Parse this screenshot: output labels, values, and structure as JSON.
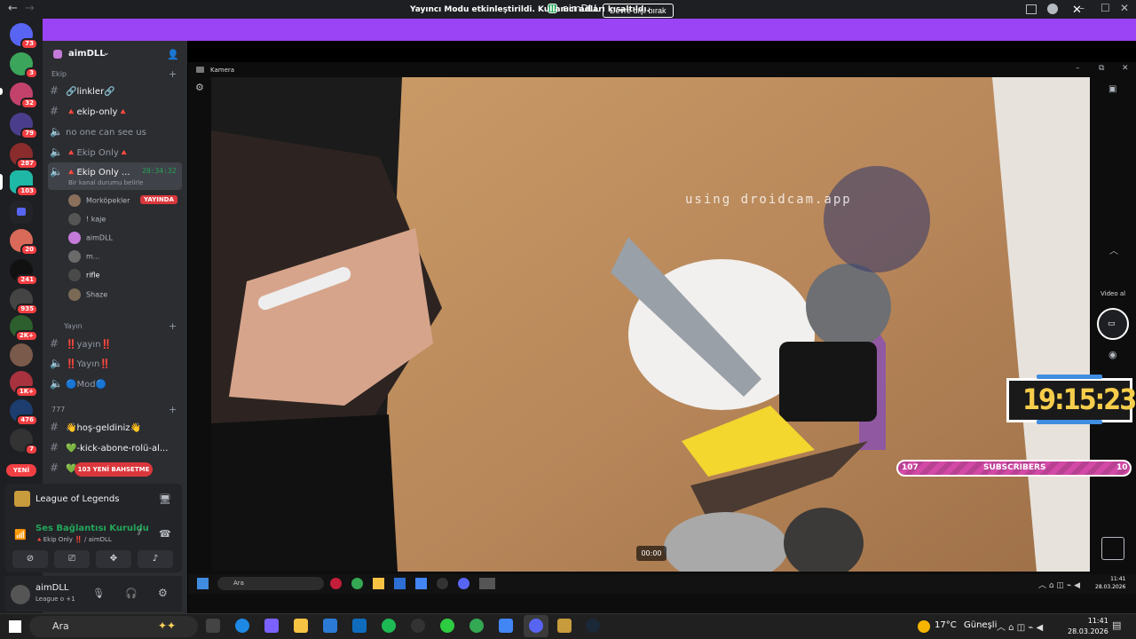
{
  "window": {
    "title": "aimDLL",
    "back": "←",
    "forward": "→",
    "minimize": "–",
    "maximize": "☐",
    "close": "✕"
  },
  "banner": {
    "text": "Yayıncı Modu etkinleştirildi. Kullanıcı adları kısaltıldı.",
    "button": "Devre dışı bırak",
    "close": "✕"
  },
  "rail": {
    "badges": [
      "73",
      "3",
      "32",
      "79",
      "287",
      "103",
      "20",
      "241",
      "935",
      "2K+",
      "1K+",
      "476",
      "7"
    ],
    "yeni": "YENİ"
  },
  "sidebar": {
    "server_name": "aimDLL",
    "categories": {
      "ekip": "Ekip",
      "yayin": "Yayın",
      "seven": "777"
    },
    "channels": [
      {
        "name": "🔗linkler🔗",
        "type": "text"
      },
      {
        "name": "🔺ekip-only🔺",
        "type": "text"
      },
      {
        "name": "no one can see us",
        "type": "voice"
      },
      {
        "name": "🔺Ekip Only🔺",
        "type": "voice"
      },
      {
        "name": "🔺Ekip Only ...",
        "type": "voice",
        "timer": "20:34:32",
        "status": "Bir kanal durumu belirle"
      }
    ],
    "members": [
      {
        "name": "Morköpekler",
        "live": "YAYINDA"
      },
      {
        "name": "! kaje"
      },
      {
        "name": "aimDLL"
      },
      {
        "name": "m..."
      },
      {
        "name": "rifle"
      },
      {
        "name": "Shaze"
      }
    ],
    "yayin_channels": [
      "‼️yayın‼️",
      "‼️Yayın‼️",
      "🔵Mod🔵"
    ],
    "seven_channels": [
      "👋hoş-geldiniz👋",
      "💚-kick-abone-rolü-al...",
      "💚"
    ],
    "new_mentions": "103 YENİ BAHSETME"
  },
  "voice_panel": {
    "game": "League of Legends",
    "status": "Ses Bağlantısı Kuruldu",
    "channel": "🔺Ekip Only ‼️ / aimDLL"
  },
  "user_panel": {
    "name": "aimDLL",
    "activity": "League o +1"
  },
  "video": {
    "title": "Kamera",
    "watermark": "using droidcam.app",
    "timestamp": "00:00",
    "clock": "19:15:23",
    "subs_left": "107",
    "subs_label": "SUBSCRIBERS",
    "subs_right": "10",
    "record_label": "Video al"
  },
  "inner_taskbar": {
    "search": "Ara",
    "time": "11:41",
    "date": "28.03.2026"
  },
  "taskbar": {
    "search": "Ara",
    "weather_temp": "17°C",
    "weather_desc": "Güneşli",
    "time": "11:41",
    "date": "28.03.2026"
  },
  "colors": {
    "banner": "#9b44f5",
    "badge": "#f23f43",
    "clock": "#f6cd4b",
    "subs_bar": "#d24aa6",
    "voice_green": "#23a559"
  }
}
